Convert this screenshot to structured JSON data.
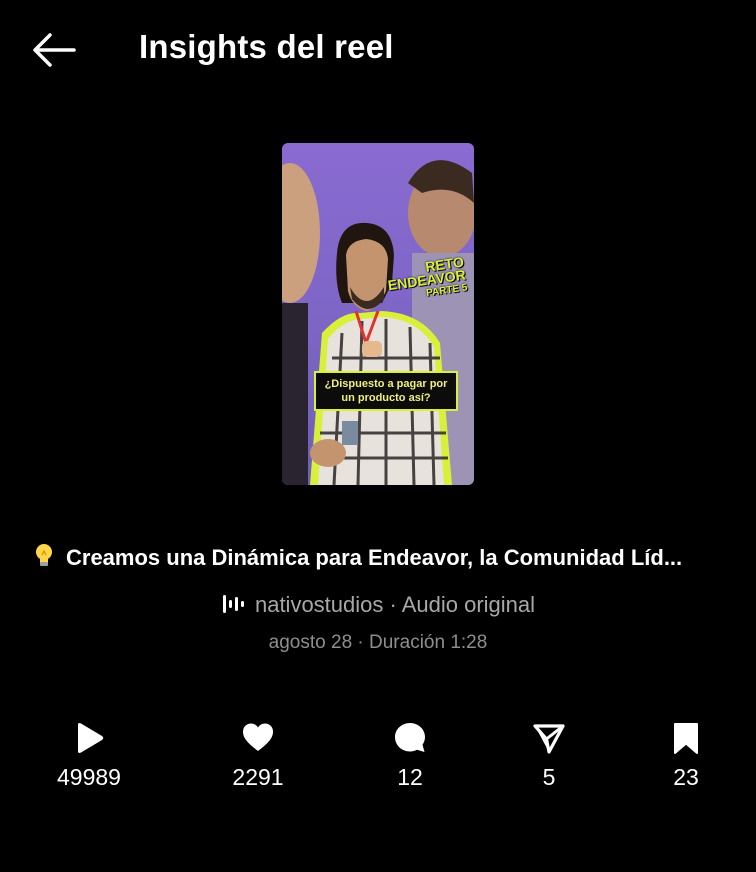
{
  "header": {
    "title": "Insights del reel"
  },
  "reel": {
    "overlay_reto": "RETO",
    "overlay_endeavor": "ENDEAVOR",
    "overlay_parte": "PARTE 5",
    "overlay_caption": "¿Dispuesto a pagar por un producto así?"
  },
  "post": {
    "title": "Creamos una Dinámica para Endeavor, la Comunidad Líd...",
    "audio": "nativostudios · Audio original",
    "meta": "agosto 28 · Duración 1:28"
  },
  "stats": {
    "plays": "49989",
    "likes": "2291",
    "comments": "12",
    "shares": "5",
    "saves": "23"
  },
  "colors": {
    "accent": "#d9f03a",
    "background": "#000000"
  }
}
